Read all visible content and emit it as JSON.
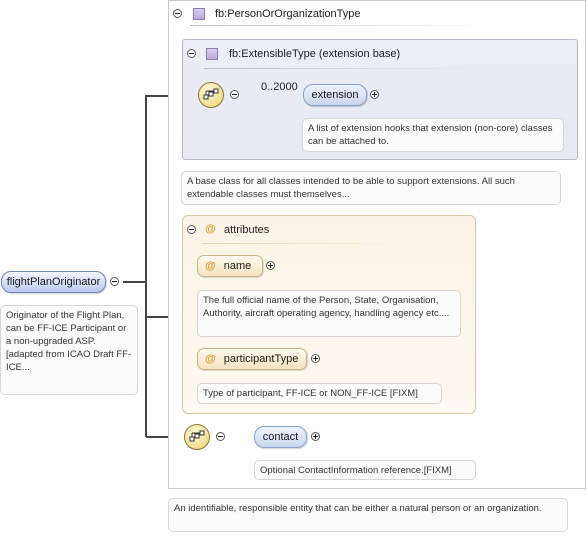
{
  "root": {
    "name": "flightPlanOriginator",
    "documentation": "Originator of the Flight Plan, can be FF-ICE Participant or a non-upgraded ASP. [adapted from ICAO Draft FF-ICE..."
  },
  "type": {
    "name": "fb:PersonOrOrganizationType",
    "documentation": "An identifiable, responsible entity that can be either a natural person or an organization."
  },
  "base": {
    "name": "fb:ExtensibleType (extension base)",
    "documentation": "A base class for all classes intended to be able to support extensions. All such extendable classes must themselves...",
    "extension": {
      "cardinality": "0..2000",
      "name": "extension",
      "documentation": "A list of extension hooks that extension (non-core) classes can be attached to."
    }
  },
  "attributes": {
    "title": "attributes",
    "items": [
      {
        "name": "name",
        "documentation": "The full official name of the Person, State, Organisation, Authority, aircraft operating agency, handling agency etc...."
      },
      {
        "name": "participantType",
        "documentation": "Type of participant, FF-ICE or NON_FF-ICE [FIXM]"
      }
    ]
  },
  "contact": {
    "name": "contact",
    "documentation": "Optional ContactInformation reference.[FIXM]"
  },
  "icons": {
    "collapse": "minus-circle-icon",
    "expand": "plus-circle-icon",
    "complex_type": "complex-type-icon",
    "sequence": "sequence-compositor-icon",
    "attribute": "at-sign-icon"
  }
}
